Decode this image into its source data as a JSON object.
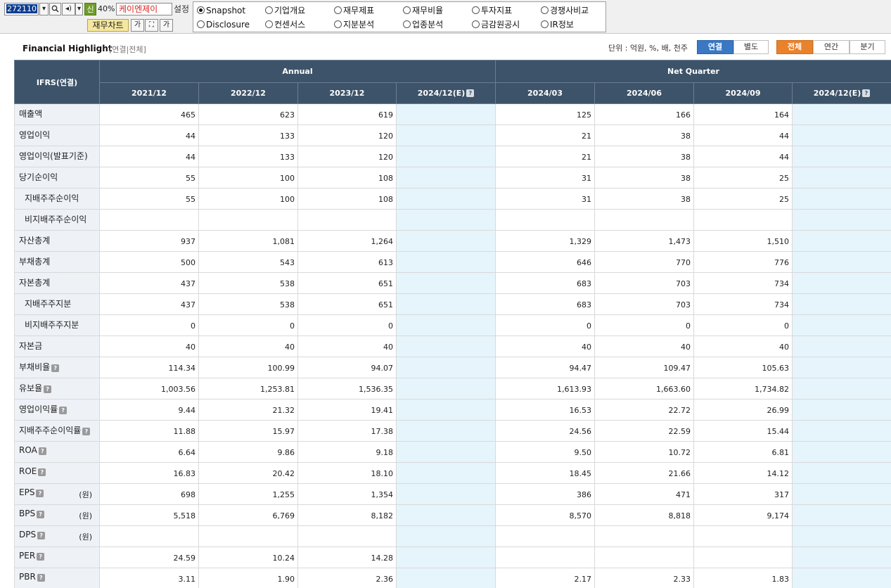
{
  "toolbar": {
    "code": "272110",
    "sin_label": "신",
    "percent": "40%",
    "company_name": "케이엔제이",
    "setting_label": "설정",
    "chart_button": "재무차트",
    "font_up_label": "가",
    "font_down_label": "가"
  },
  "menu": {
    "row1": [
      {
        "label": "Snapshot",
        "selected": true
      },
      {
        "label": "기업개요",
        "selected": false
      },
      {
        "label": "재무제표",
        "selected": false
      },
      {
        "label": "재무비율",
        "selected": false
      },
      {
        "label": "투자지표",
        "selected": false
      },
      {
        "label": "경쟁사비교",
        "selected": false
      }
    ],
    "row2": [
      {
        "label": "Disclosure",
        "selected": false
      },
      {
        "label": "컨센서스",
        "selected": false
      },
      {
        "label": "지분분석",
        "selected": false
      },
      {
        "label": "업종분석",
        "selected": false
      },
      {
        "label": "금감원공시",
        "selected": false
      },
      {
        "label": "IR정보",
        "selected": false
      }
    ]
  },
  "section": {
    "title": "Financial Highlight",
    "subtitle": "[연결|전체]",
    "unit_text": "단위 : 억원, %, 배, 천주",
    "toggle_consolidation": [
      {
        "label": "연결",
        "active": true
      },
      {
        "label": "별도",
        "active": false
      }
    ],
    "toggle_period": [
      {
        "label": "전체",
        "active": true
      },
      {
        "label": "연간",
        "active": false
      },
      {
        "label": "분기",
        "active": false
      }
    ]
  },
  "table": {
    "corner": "IFRS(연결)",
    "group_annual": "Annual",
    "group_quarter": "Net Quarter",
    "columns": [
      "2021/12",
      "2022/12",
      "2023/12",
      "2024/12(E)",
      "2024/03",
      "2024/06",
      "2024/09",
      "2024/12(E)"
    ],
    "rows": [
      {
        "label": "매출액",
        "values": [
          "465",
          "623",
          "619",
          "",
          "125",
          "166",
          "164",
          ""
        ]
      },
      {
        "label": "영업이익",
        "values": [
          "44",
          "133",
          "120",
          "",
          "21",
          "38",
          "44",
          ""
        ]
      },
      {
        "label": "영업이익(발표기준)",
        "values": [
          "44",
          "133",
          "120",
          "",
          "21",
          "38",
          "44",
          ""
        ]
      },
      {
        "label": "당기순이익",
        "values": [
          "55",
          "100",
          "108",
          "",
          "31",
          "38",
          "25",
          ""
        ]
      },
      {
        "label": "지배주주순이익",
        "indent": true,
        "values": [
          "55",
          "100",
          "108",
          "",
          "31",
          "38",
          "25",
          ""
        ]
      },
      {
        "label": "비지배주주순이익",
        "indent": true,
        "values": [
          "",
          "",
          "",
          "",
          "",
          "",
          "",
          ""
        ]
      },
      {
        "label": "자산총계",
        "values": [
          "937",
          "1,081",
          "1,264",
          "",
          "1,329",
          "1,473",
          "1,510",
          ""
        ]
      },
      {
        "label": "부채총계",
        "values": [
          "500",
          "543",
          "613",
          "",
          "646",
          "770",
          "776",
          ""
        ]
      },
      {
        "label": "자본총계",
        "values": [
          "437",
          "538",
          "651",
          "",
          "683",
          "703",
          "734",
          ""
        ]
      },
      {
        "label": "지배주주지분",
        "indent": true,
        "values": [
          "437",
          "538",
          "651",
          "",
          "683",
          "703",
          "734",
          ""
        ]
      },
      {
        "label": "비지배주주지분",
        "indent": true,
        "values": [
          "0",
          "0",
          "0",
          "",
          "0",
          "0",
          "0",
          ""
        ]
      },
      {
        "label": "자본금",
        "values": [
          "40",
          "40",
          "40",
          "",
          "40",
          "40",
          "40",
          ""
        ]
      },
      {
        "label": "부채비율",
        "help": true,
        "values": [
          "114.34",
          "100.99",
          "94.07",
          "",
          "94.47",
          "109.47",
          "105.63",
          ""
        ]
      },
      {
        "label": "유보율",
        "help": true,
        "values": [
          "1,003.56",
          "1,253.81",
          "1,536.35",
          "",
          "1,613.93",
          "1,663.60",
          "1,734.82",
          ""
        ]
      },
      {
        "label": "영업이익률",
        "help": true,
        "values": [
          "9.44",
          "21.32",
          "19.41",
          "",
          "16.53",
          "22.72",
          "26.99",
          ""
        ]
      },
      {
        "label": "지배주주순이익률",
        "help": true,
        "values": [
          "11.88",
          "15.97",
          "17.38",
          "",
          "24.56",
          "22.59",
          "15.44",
          ""
        ]
      },
      {
        "label": "ROA",
        "help": true,
        "values": [
          "6.64",
          "9.86",
          "9.18",
          "",
          "9.50",
          "10.72",
          "6.81",
          ""
        ]
      },
      {
        "label": "ROE",
        "help": true,
        "values": [
          "16.83",
          "20.42",
          "18.10",
          "",
          "18.45",
          "21.66",
          "14.12",
          ""
        ]
      },
      {
        "label": "EPS",
        "help": true,
        "unit": "(원)",
        "values": [
          "698",
          "1,255",
          "1,354",
          "",
          "386",
          "471",
          "317",
          ""
        ]
      },
      {
        "label": "BPS",
        "help": true,
        "unit": "(원)",
        "values": [
          "5,518",
          "6,769",
          "8,182",
          "",
          "8,570",
          "8,818",
          "9,174",
          ""
        ]
      },
      {
        "label": "DPS",
        "help": true,
        "unit": "(원)",
        "values": [
          "",
          "",
          "",
          "",
          "",
          "",
          "",
          ""
        ]
      },
      {
        "label": "PER",
        "help": true,
        "values": [
          "24.59",
          "10.24",
          "14.28",
          "",
          "",
          "",
          "",
          ""
        ]
      },
      {
        "label": "PBR",
        "help": true,
        "values": [
          "3.11",
          "1.90",
          "2.36",
          "",
          "2.17",
          "2.33",
          "1.83",
          ""
        ]
      }
    ]
  }
}
